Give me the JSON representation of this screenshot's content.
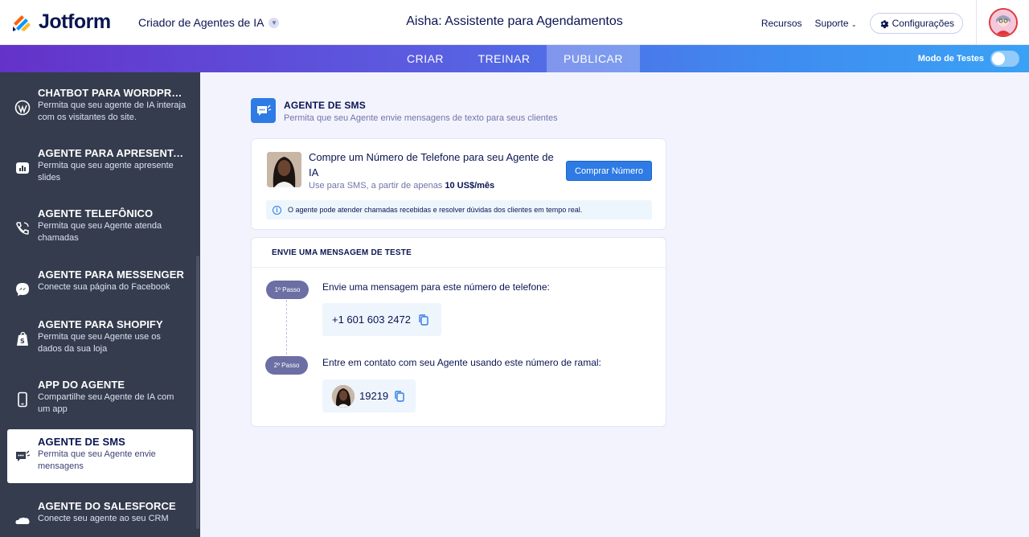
{
  "header": {
    "brand": "Jotform",
    "breadcrumb": "Criador de Agentes de IA",
    "title": "Aisha: Assistente para Agendamentos",
    "links": {
      "resources": "Recursos",
      "support": "Suporte",
      "settings": "Configurações"
    }
  },
  "tabs": {
    "create": "CRIAR",
    "train": "TREINAR",
    "publish": "PUBLICAR",
    "active": "publish"
  },
  "test_mode": {
    "label": "Modo de Testes",
    "enabled": false
  },
  "sidebar": {
    "items": [
      {
        "title": "CHATBOT PARA WORDPRESS",
        "desc": "Permita que seu agente de IA interaja com os visitantes do site.",
        "icon": "wordpress-icon"
      },
      {
        "title": "AGENTE PARA APRESENTAÇÕES",
        "desc": "Permita que seu agente apresente slides",
        "icon": "presentation-icon"
      },
      {
        "title": "AGENTE TELEFÔNICO",
        "desc": "Permita que seu Agente atenda chamadas",
        "icon": "phone-icon"
      },
      {
        "title": "AGENTE PARA MESSENGER",
        "desc": "Conecte sua página do Facebook",
        "icon": "messenger-icon"
      },
      {
        "title": "AGENTE PARA SHOPIFY",
        "desc": "Permita que seu Agente use os dados da sua loja",
        "icon": "shopify-icon"
      },
      {
        "title": "APP DO AGENTE",
        "desc": "Compartilhe seu Agente de IA com um app",
        "icon": "mobile-app-icon"
      },
      {
        "title": "AGENTE DE SMS",
        "desc": "Permita que seu Agente envie mensagens",
        "icon": "sms-icon"
      },
      {
        "title": "AGENTE DO SALESFORCE",
        "desc": "Conecte seu agente ao seu CRM",
        "icon": "salesforce-icon"
      }
    ],
    "active_index": 6
  },
  "section": {
    "title": "AGENTE DE SMS",
    "subtitle": "Permita que seu Agente envie mensagens de texto para seus clientes"
  },
  "buy_card": {
    "title": "Compre um Número de Telefone para seu Agente de IA",
    "sub_prefix": "Use para SMS, a partir de apenas",
    "price": "10 US$/mês",
    "button": "Comprar Número",
    "info": "O agente pode atender chamadas recebidas e resolver dúvidas dos clientes em tempo real."
  },
  "test_card": {
    "heading": "ENVIE UMA MENSAGEM DE TESTE",
    "step1_label": "1º Passo",
    "step1_text": "Envie uma mensagem para este número de telefone:",
    "phone_number": "+1 601 603 2472",
    "step2_label": "2º Passo",
    "step2_text": "Entre em contato com seu Agente usando este número de ramal:",
    "extension": "19219"
  },
  "colors": {
    "accent": "#2e7be5",
    "sidebar_bg": "#343c4d",
    "text_dark": "#0a1551",
    "step_pill": "#6b6fa3"
  }
}
